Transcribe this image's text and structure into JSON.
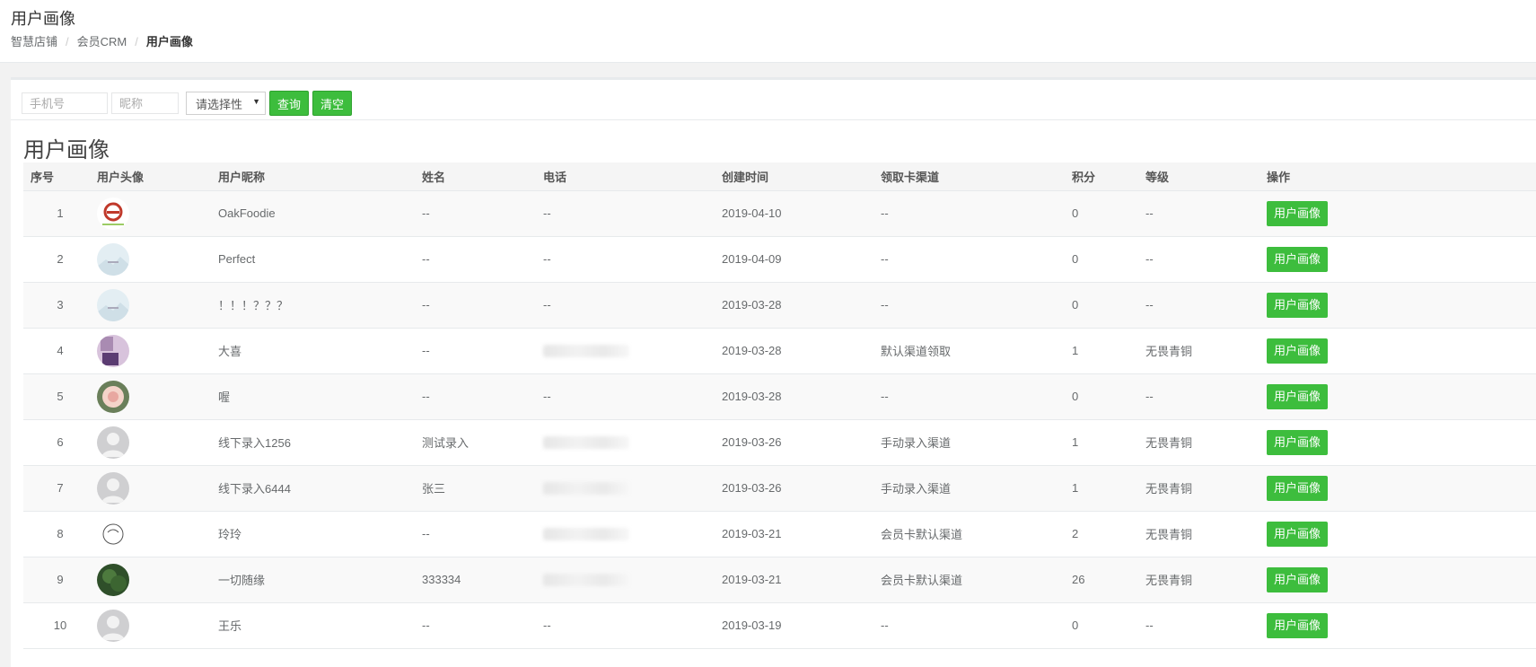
{
  "header": {
    "title": "用户画像",
    "breadcrumb": [
      "智慧店铺",
      "会员CRM",
      "用户画像"
    ]
  },
  "filters": {
    "phone_placeholder": "手机号",
    "nickname_placeholder": "昵称",
    "select_value": "请选择性",
    "query_label": "查询",
    "clear_label": "清空"
  },
  "section_title": "用户画像",
  "columns": [
    "序号",
    "用户头像",
    "用户昵称",
    "姓名",
    "电话",
    "创建时间",
    "领取卡渠道",
    "积分",
    "等级",
    "操作"
  ],
  "rows": [
    {
      "no": "1",
      "avatar": "logo-avatar",
      "nickname": "OakFoodie",
      "name": "--",
      "phone": "--",
      "created": "2019-04-10",
      "channel": "--",
      "points": "0",
      "level": "--",
      "action": "用户画像"
    },
    {
      "no": "2",
      "avatar": "landscape-avatar",
      "nickname": "Perfect",
      "name": "--",
      "phone": "--",
      "created": "2019-04-09",
      "channel": "--",
      "points": "0",
      "level": "--",
      "action": "用户画像"
    },
    {
      "no": "3",
      "avatar": "landscape-avatar",
      "nickname": "！！！？？？",
      "name": "--",
      "phone": "--",
      "created": "2019-03-28",
      "channel": "--",
      "points": "0",
      "level": "--",
      "action": "用户画像"
    },
    {
      "no": "4",
      "avatar": "purple-avatar",
      "nickname": "大喜",
      "name": "--",
      "phone": "",
      "created": "2019-03-28",
      "channel": "默认渠道领取",
      "points": "1",
      "level": "无畏青铜",
      "action": "用户画像"
    },
    {
      "no": "5",
      "avatar": "flower-avatar",
      "nickname": "喔",
      "name": "--",
      "phone": "--",
      "created": "2019-03-28",
      "channel": "--",
      "points": "0",
      "level": "--",
      "action": "用户画像"
    },
    {
      "no": "6",
      "avatar": "default-avatar",
      "nickname": "线下录入1256",
      "name": "测试录入",
      "phone": "",
      "created": "2019-03-26",
      "channel": "手动录入渠道",
      "points": "1",
      "level": "无畏青铜",
      "action": "用户画像"
    },
    {
      "no": "7",
      "avatar": "default-avatar",
      "nickname": "线下录入6444",
      "name": "张三",
      "phone": "",
      "created": "2019-03-26",
      "channel": "手动录入渠道",
      "points": "1",
      "level": "无畏青铜",
      "action": "用户画像"
    },
    {
      "no": "8",
      "avatar": "sketch-avatar",
      "nickname": "玲玲",
      "name": "--",
      "phone": "",
      "created": "2019-03-21",
      "channel": "会员卡默认渠道",
      "points": "2",
      "level": "无畏青铜",
      "action": "用户画像"
    },
    {
      "no": "9",
      "avatar": "tree-avatar",
      "nickname": "一切随缘",
      "name": "333334",
      "phone": "",
      "created": "2019-03-21",
      "channel": "会员卡默认渠道",
      "points": "26",
      "level": "无畏青铜",
      "action": "用户画像"
    },
    {
      "no": "10",
      "avatar": "default-avatar",
      "nickname": "王乐",
      "name": "--",
      "phone": "--",
      "created": "2019-03-19",
      "channel": "--",
      "points": "0",
      "level": "--",
      "action": "用户画像"
    }
  ],
  "colors": {
    "accent": "#3dbd3d"
  }
}
